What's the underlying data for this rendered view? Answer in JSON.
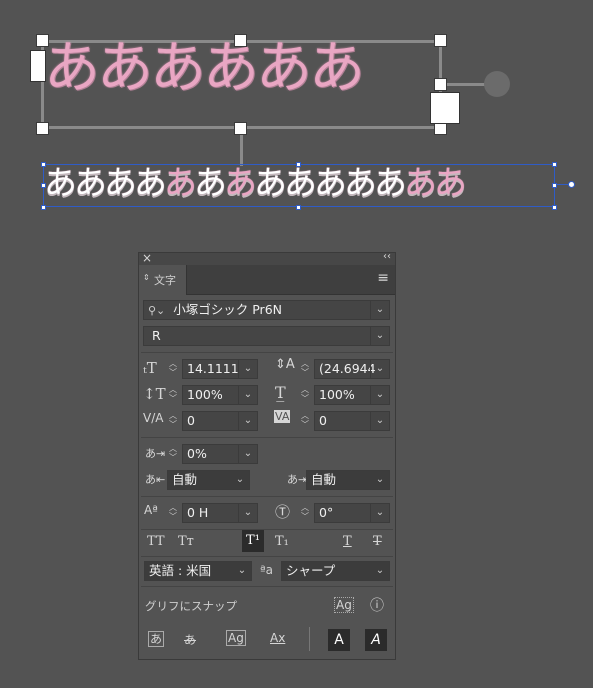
{
  "canvas": {
    "large_text": "ああああああ",
    "small_text_parts": [
      "ああああ",
      "あ",
      "あ",
      "あ",
      "あああああ",
      "ああ"
    ]
  },
  "panel": {
    "close_glyph": "×",
    "collapse_glyph": "‹‹",
    "tab_label": "文字",
    "menu_glyph": "≡",
    "font_family": "小塚ゴシック Pr6N",
    "font_style": "R",
    "font_size": "14.1111",
    "leading": "(24.6944",
    "vertical_scale": "100%",
    "horizontal_scale": "100%",
    "kerning": "0",
    "tracking": "0",
    "tsume": "0%",
    "aki_left": "自動",
    "aki_right": "自動",
    "baseline_shift": "0 H",
    "rotation": "0°",
    "case_buttons": [
      "TT",
      "Tт",
      "T¹",
      "T₁",
      "T",
      "T"
    ],
    "language": "英語 : 米国",
    "anti_alias_icon_label": "ªa",
    "anti_alias": "シャープ",
    "snap_label": "グリフにスナップ",
    "snap_icons": [
      "あ",
      "あ",
      "Ag",
      "Ax"
    ],
    "bottom_glyphs": [
      "A",
      "A"
    ]
  },
  "colors": {
    "background": "#535353",
    "pink_text": "#e9a6c3",
    "selection_blue": "#2f5cc7"
  }
}
